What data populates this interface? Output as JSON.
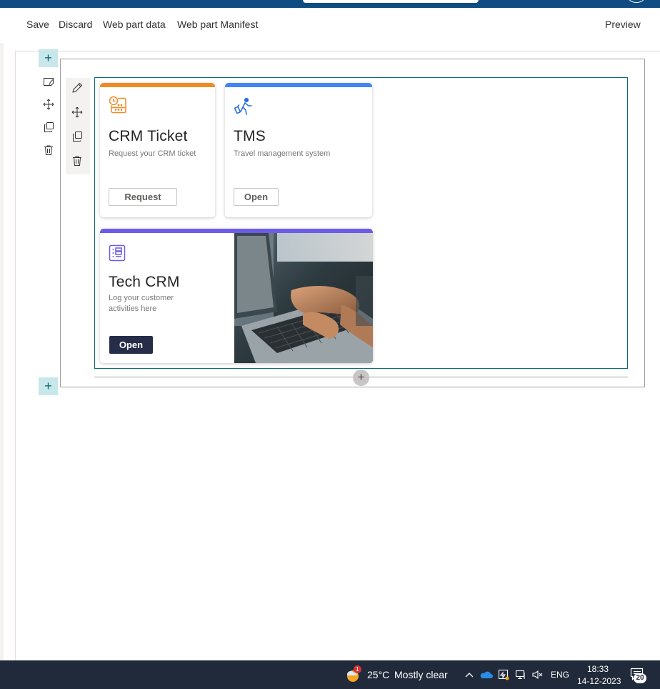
{
  "commands": {
    "save": "Save",
    "discard": "Discard",
    "web_part_data": "Web part data",
    "web_part_manifest": "Web part Manifest",
    "preview": "Preview"
  },
  "section": {
    "add_label": "+",
    "tools": [
      "edit-section-icon",
      "move-icon",
      "duplicate-icon",
      "delete-icon"
    ]
  },
  "webpart_tools": [
    "pencil-icon",
    "move-icon",
    "duplicate-icon",
    "delete-icon"
  ],
  "cards": [
    {
      "title": "CRM Ticket",
      "description": "Request your CRM ticket",
      "button": "Request",
      "accent": "#ee8b25",
      "icon": "calendar-clock-icon"
    },
    {
      "title": "TMS",
      "description": "Travel management system",
      "button": "Open",
      "accent": "#4285f4",
      "icon": "traveler-icon"
    },
    {
      "title": "Tech CRM",
      "description": "Log your customer activities here",
      "button": "Open",
      "accent": "#6c5ce7",
      "icon": "list-icon",
      "image": "laptop-typing-photo"
    }
  ],
  "taskbar": {
    "weather_badge": "1",
    "temperature": "25°C",
    "weather_text": "Mostly clear",
    "language": "ENG",
    "time": "18:33",
    "date": "14-12-2023",
    "notifications": "20"
  },
  "colors": {
    "brand": "#0f4c81",
    "add_button": "#c7e7ea",
    "webpart_border": "#0b6a77",
    "primary_button": "#252d48"
  }
}
